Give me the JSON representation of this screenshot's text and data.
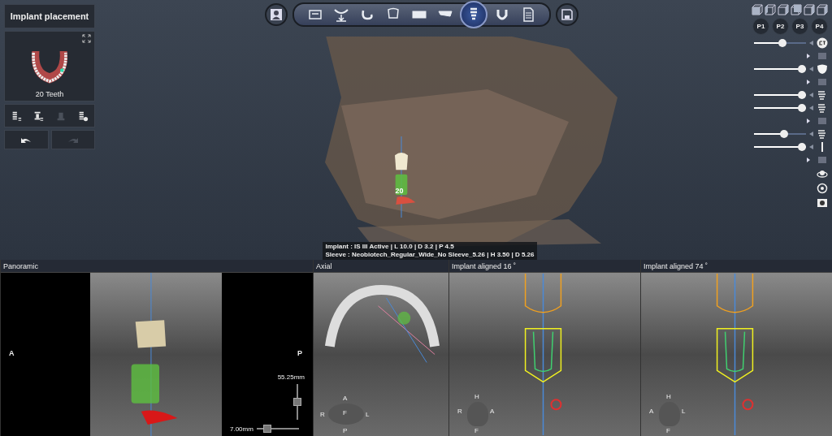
{
  "left_panel": {
    "title": "Implant placement",
    "teeth_label": "20 Teeth",
    "tools": [
      {
        "kind": "implants",
        "disabled": false
      },
      {
        "kind": "sleeve",
        "disabled": false
      },
      {
        "kind": "abutment",
        "disabled": true
      },
      {
        "kind": "settings",
        "disabled": false
      }
    ],
    "history": [
      {
        "kind": "undo",
        "disabled": false
      },
      {
        "kind": "redo",
        "disabled": true
      }
    ]
  },
  "toolbar": {
    "steps": [
      {
        "kind": "ct",
        "selected": false
      },
      {
        "kind": "curve",
        "selected": false
      },
      {
        "kind": "nerve",
        "selected": false
      },
      {
        "kind": "segment",
        "selected": false
      },
      {
        "kind": "scan",
        "selected": false
      },
      {
        "kind": "model",
        "selected": false
      },
      {
        "kind": "implant",
        "selected": true
      },
      {
        "kind": "arch",
        "selected": false
      },
      {
        "kind": "report",
        "selected": false
      }
    ]
  },
  "scene": {
    "implant_number": "20",
    "implant_info": [
      "Implant : IS III Active | L 10.0 | D 3.2 | P 4.5",
      "Sleeve : Neobiotech_Regular_Wide_No Sleeve_5.26 | H 3.50 | D 5.26"
    ]
  },
  "right_panel": {
    "presets": [
      "P1",
      "P2",
      "P3",
      "P4"
    ],
    "layers": [
      {
        "kind": "slider",
        "level": 0.55
      },
      {
        "kind": "toggle"
      },
      {
        "kind": "slider",
        "level": 1
      },
      {
        "kind": "toggle"
      },
      {
        "kind": "slider",
        "level": 1
      },
      {
        "kind": "slider",
        "level": 1
      },
      {
        "kind": "toggle"
      },
      {
        "kind": "slider",
        "level": 0.6
      },
      {
        "kind": "slider",
        "level": 1
      },
      {
        "kind": "toggle"
      }
    ]
  },
  "views": [
    {
      "kind": "panoramic",
      "title": "Panoramic",
      "left_label": "A",
      "right_label": "P",
      "height_reading": "55.25mm",
      "width_reading": "7.00mm",
      "height_slider": {
        "level": 0.5
      },
      "width_slider": {
        "level": 0.2
      }
    },
    {
      "kind": "axial",
      "title": "Axial",
      "orientation": [
        "A",
        "R",
        "F",
        "L",
        "P"
      ]
    },
    {
      "kind": "aligned",
      "title": "Implant aligned 16 ˚",
      "orientation": [
        "H",
        "R",
        "A",
        "F"
      ]
    },
    {
      "kind": "aligned",
      "title": "Implant aligned 74 ˚",
      "orientation": [
        "H",
        "A",
        "L",
        "F"
      ]
    }
  ]
}
